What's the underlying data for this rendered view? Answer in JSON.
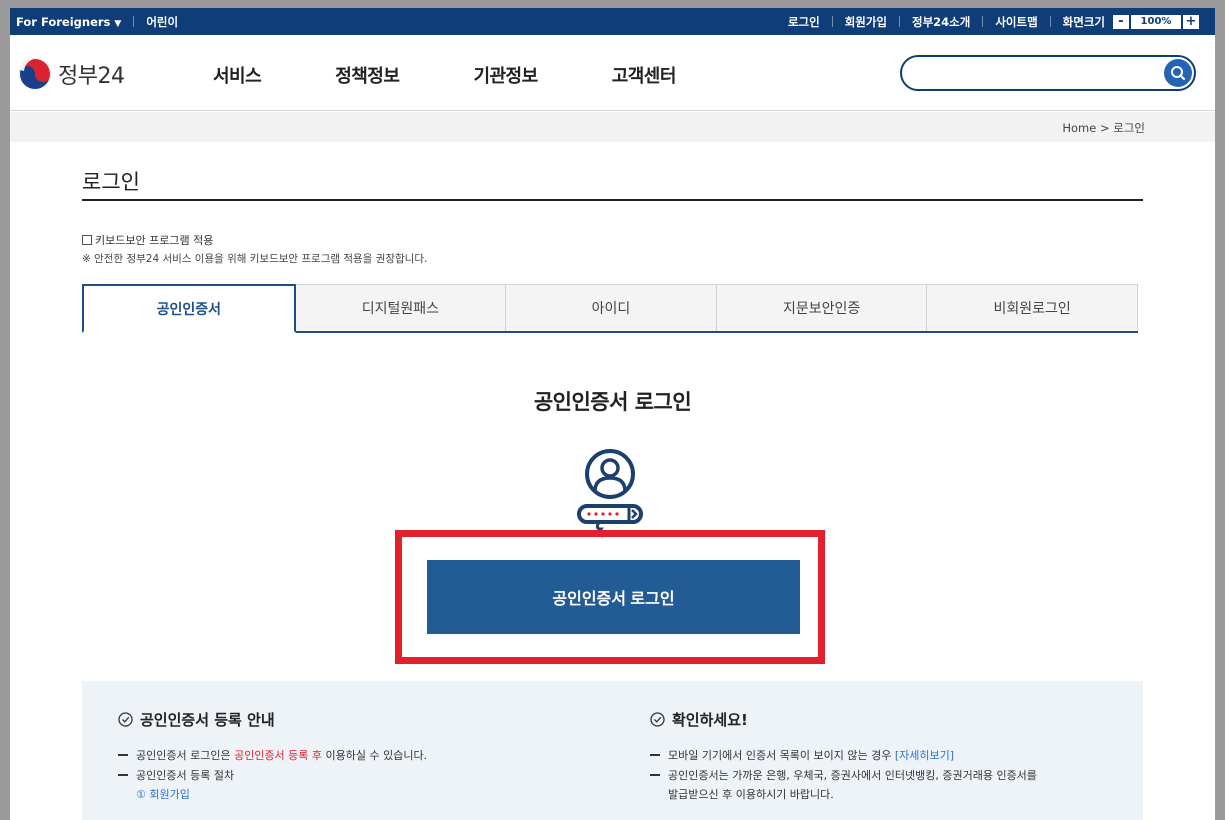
{
  "topbar": {
    "foreigners": "For Foreigners",
    "kids": "어린이",
    "login": "로그인",
    "signup": "회원가입",
    "about": "정부24소개",
    "sitemap": "사이트맵",
    "screen_size": "화면크기",
    "zoom_minus": "-",
    "zoom_value": "100%",
    "zoom_plus": "+"
  },
  "header": {
    "logo": "정부24",
    "nav": [
      "서비스",
      "정책정보",
      "기관정보",
      "고객센터"
    ],
    "search_value": ""
  },
  "breadcrumb": "Home > 로그인",
  "page_title": "로그인",
  "keyboard_security": {
    "label": "키보드보안 프로그램 적용",
    "note": "※ 안전한 정부24 서비스 이용을 위해 키보드보안 프로그램 적용을 권장합니다."
  },
  "tabs": [
    "공인인증서",
    "디지털원패스",
    "아이디",
    "지문보안인증",
    "비회원로그인"
  ],
  "active_tab": "공인인증서",
  "main": {
    "heading": "공인인증서 로그인",
    "button_label": "공인인증서 로그인"
  },
  "info": {
    "left_title": "공인인증서 등록 안내",
    "left_item1_pre": "공인인증서 로그인은 ",
    "left_item1_red": "공인인증서 등록 후",
    "left_item1_post": " 이용하실 수 있습니다.",
    "left_item2": "공인인증서 등록 절차",
    "left_sub1": "① 회원가입",
    "right_title": "확인하세요!",
    "right_item1_pre": "모바일 기기에서 인증서 목록이 보이지 않는 경우 ",
    "right_item1_link": "[자세히보기]",
    "right_item2_line1": "공인인증서는 가까운 은행, 우체국, 증권사에서 인터넷뱅킹, 증권거래용 인증서를",
    "right_item2_line2": "발급받으신 후 이용하시기 바랍니다."
  },
  "colors": {
    "navy": "#0f3d78",
    "button": "#235b94",
    "highlight": "#e3202b"
  }
}
